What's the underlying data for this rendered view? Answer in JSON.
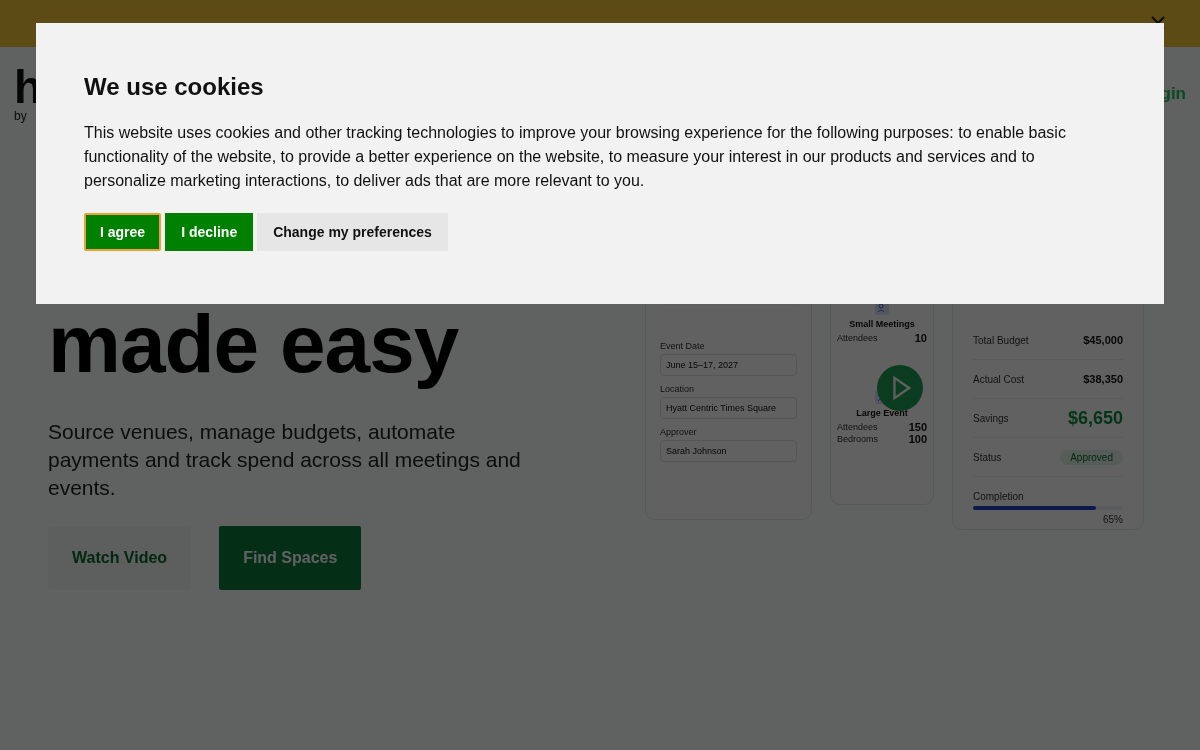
{
  "header": {
    "logo": "h",
    "logo_tagline": "by",
    "login": "gin"
  },
  "hero": {
    "heading": "made easy",
    "description": "Source venues, manage budgets, automate payments and track spend across all meetings and events.",
    "buttons": [
      {
        "label": "Watch Video",
        "kind": "secondary"
      },
      {
        "label": "Find Spaces",
        "kind": "primary"
      }
    ]
  },
  "mockup": {
    "builder": {
      "fields": [
        {
          "label": "Event Date",
          "value": "June 15–17, 2027"
        },
        {
          "label": "Location",
          "value": "Hyatt Centric Times Square"
        },
        {
          "label": "Approver",
          "value": "Sarah Johnson"
        }
      ]
    },
    "events": [
      {
        "title": "Small Meetings",
        "rows": [
          {
            "label": "Attendees",
            "value": "10"
          }
        ]
      },
      {
        "title": "Large Event",
        "rows": [
          {
            "label": "Attendees",
            "value": "150"
          },
          {
            "label": "Bedrooms",
            "value": "100"
          }
        ]
      }
    ],
    "summary": {
      "rows": [
        {
          "label": "Total Budget",
          "value": "$45,000",
          "kind": "amount"
        },
        {
          "label": "Actual Cost",
          "value": "$38,350",
          "kind": "amount"
        },
        {
          "label": "Savings",
          "value": "$6,650",
          "kind": "highlight"
        },
        {
          "label": "Status",
          "value": "Approved",
          "kind": "badge"
        }
      ],
      "completion": {
        "label": "Completion",
        "level": 0.82,
        "reading": "65%"
      }
    }
  },
  "cookie_dialog": {
    "title": "We use cookies",
    "body": "This website uses cookies and other tracking technologies to improve your browsing experience for the following purposes: to enable basic functionality of the website, to provide a better experience on the website, to measure your interest in our products and services and to personalize marketing interactions, to deliver ads that are more relevant to you.",
    "buttons": [
      {
        "label": "I agree",
        "kind": "primary",
        "focused": true
      },
      {
        "label": "I decline",
        "kind": "primary",
        "focused": false
      },
      {
        "label": "Change my preferences",
        "kind": "secondary",
        "focused": false
      }
    ]
  }
}
